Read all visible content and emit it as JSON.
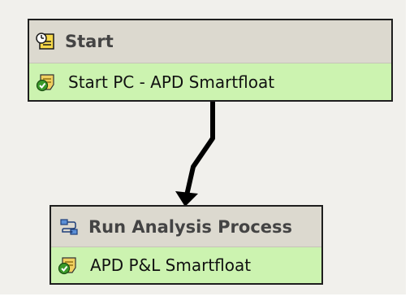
{
  "nodes": [
    {
      "title": "Start",
      "title_icon": "clock-note-icon",
      "step": "Start PC - APD Smartfloat",
      "step_icon": "check-clipboard-icon"
    },
    {
      "title": "Run Analysis Process",
      "title_icon": "process-flow-icon",
      "step": "APD P&L Smartfloat",
      "step_icon": "check-clipboard-icon"
    }
  ],
  "colors": {
    "canvas": "#f1f0ec",
    "node_header": "#dcd9cf",
    "node_step": "#ccf3b0",
    "border": "#1e1e1e",
    "connector": "#000000"
  }
}
